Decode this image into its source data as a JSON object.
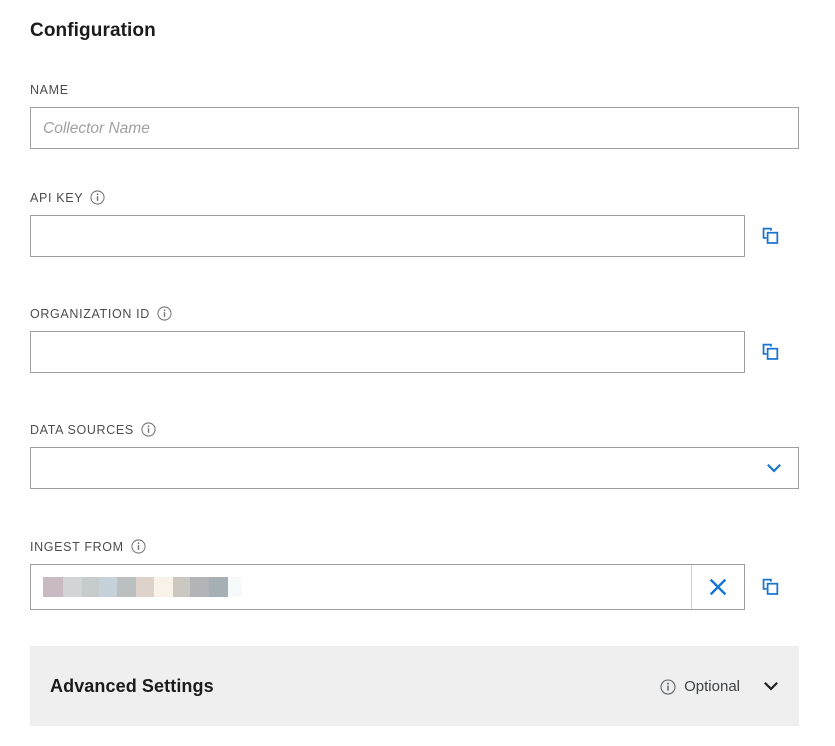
{
  "panel": {
    "title": "Configuration"
  },
  "fields": {
    "name": {
      "label": "NAME",
      "placeholder": "Collector Name",
      "value": ""
    },
    "api_key": {
      "label": "API KEY",
      "value": "",
      "info_icon": "info-icon",
      "copy_icon": "copy-icon"
    },
    "organization_id": {
      "label": "ORGANIZATION ID",
      "value": "",
      "info_icon": "info-icon",
      "copy_icon": "copy-icon"
    },
    "data_sources": {
      "label": "DATA SOURCES",
      "value": "",
      "info_icon": "info-icon",
      "chevron_icon": "chevron-down-icon"
    },
    "ingest_from": {
      "label": "INGEST FROM",
      "value": "",
      "redacted": true,
      "info_icon": "info-icon",
      "clear_icon": "close-icon",
      "copy_icon": "copy-icon",
      "redaction_blocks": [
        {
          "color": "#c9b9c2",
          "width": 20
        },
        {
          "color": "#d2d4d6",
          "width": 19
        },
        {
          "color": "#c6cbcb",
          "width": 17
        },
        {
          "color": "#c6d1da",
          "width": 18
        },
        {
          "color": "#bcbfbf",
          "width": 19
        },
        {
          "color": "#ded3cb",
          "width": 18
        },
        {
          "color": "#f9f2e8",
          "width": 19
        },
        {
          "color": "#cbc8c1",
          "width": 17
        },
        {
          "color": "#b3b4b8",
          "width": 19
        },
        {
          "color": "#a6afb3",
          "width": 19
        },
        {
          "color": "#f7fafb",
          "width": 14
        }
      ]
    }
  },
  "advanced_settings": {
    "title": "Advanced Settings",
    "badge": "Optional",
    "info_icon": "info-icon",
    "chevron_icon": "chevron-down-icon"
  },
  "colors": {
    "accent_blue": "#1675d1",
    "input_border": "#9e9e9e",
    "panel_gray": "#efefef",
    "label_gray": "#4d4d4d"
  }
}
